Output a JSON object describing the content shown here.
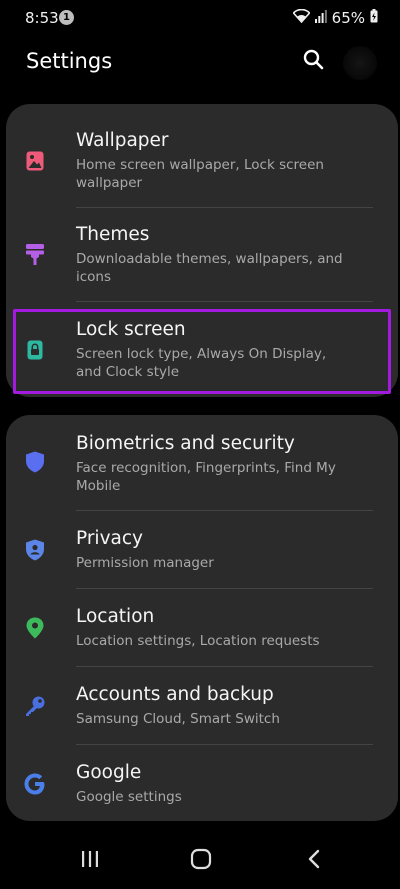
{
  "status_bar": {
    "time": "8:53",
    "notification_count": "1",
    "battery": "65%"
  },
  "header": {
    "title": "Settings",
    "search_icon": "search-icon",
    "avatar": "avatar"
  },
  "groups": [
    {
      "items": [
        {
          "title": "Wallpaper",
          "subtitle": "Home screen wallpaper, Lock screen wallpaper",
          "icon": "wallpaper-icon",
          "icon_color": "#ee5b7a"
        },
        {
          "title": "Themes",
          "subtitle": "Downloadable themes, wallpapers, and icons",
          "icon": "themes-brush-icon",
          "icon_color": "#b45fe6"
        },
        {
          "title": "Lock screen",
          "subtitle": "Screen lock type, Always On Display, and Clock style",
          "icon": "lock-screen-icon",
          "icon_color": "#2eb8a0",
          "highlighted": true
        }
      ]
    },
    {
      "items": [
        {
          "title": "Biometrics and security",
          "subtitle": "Face recognition, Fingerprints, Find My Mobile",
          "icon": "shield-icon",
          "icon_color": "#5a6ef0"
        },
        {
          "title": "Privacy",
          "subtitle": "Permission manager",
          "icon": "privacy-shield-icon",
          "icon_color": "#5b86e8"
        },
        {
          "title": "Location",
          "subtitle": "Location settings, Location requests",
          "icon": "location-pin-icon",
          "icon_color": "#3dbb5c"
        },
        {
          "title": "Accounts and backup",
          "subtitle": "Samsung Cloud, Smart Switch",
          "icon": "key-icon",
          "icon_color": "#4a6fe0"
        },
        {
          "title": "Google",
          "subtitle": "Google settings",
          "icon": "google-icon",
          "icon_color": "#4a7ee8"
        }
      ]
    }
  ],
  "highlight_color": "#a21ae0",
  "nav_bar": {
    "recents": "recents-icon",
    "home": "home-icon",
    "back": "back-icon"
  }
}
